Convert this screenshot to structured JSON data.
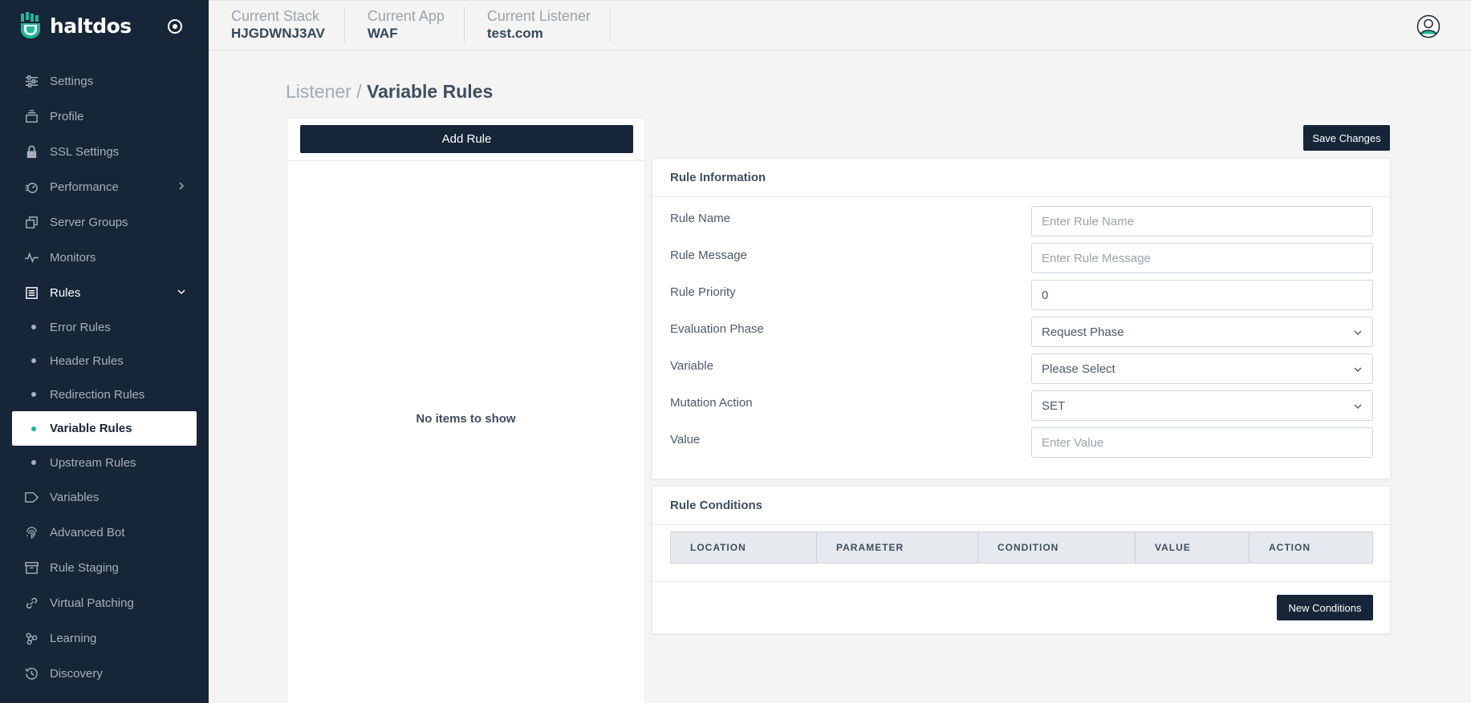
{
  "brand": {
    "name": "haltdos"
  },
  "colors": {
    "sidebar_bg": "#172538",
    "accent": "#1fb89a",
    "page_bg": "#f3f4f3"
  },
  "sidebar": {
    "items": [
      {
        "label": "Settings",
        "icon": "sliders-icon"
      },
      {
        "label": "Profile",
        "icon": "layers-icon"
      },
      {
        "label": "SSL Settings",
        "icon": "lock-icon"
      },
      {
        "label": "Performance",
        "icon": "speedometer-icon"
      },
      {
        "label": "Server Groups",
        "icon": "copy-icon"
      },
      {
        "label": "Monitors",
        "icon": "pulse-icon"
      },
      {
        "label": "Rules",
        "icon": "list-icon"
      }
    ],
    "sub_items": [
      {
        "label": "Error Rules"
      },
      {
        "label": "Header Rules"
      },
      {
        "label": "Redirection Rules"
      },
      {
        "label": "Variable Rules"
      },
      {
        "label": "Upstream Rules"
      }
    ],
    "items_after": [
      {
        "label": "Variables",
        "icon": "tag-icon"
      },
      {
        "label": "Advanced Bot",
        "icon": "fingerprint-icon"
      },
      {
        "label": "Rule Staging",
        "icon": "archive-icon"
      },
      {
        "label": "Virtual Patching",
        "icon": "link-icon"
      },
      {
        "label": "Learning",
        "icon": "network-icon"
      },
      {
        "label": "Discovery",
        "icon": "history-icon"
      }
    ]
  },
  "topbar": {
    "stack_label": "Current Stack",
    "stack_value": "HJGDWNJ3AV",
    "app_label": "Current App",
    "app_value": "WAF",
    "listener_label": "Current Listener",
    "listener_value": "test.com"
  },
  "breadcrumb": {
    "parent": "Listener /",
    "current": "Variable Rules"
  },
  "left_panel": {
    "add_rule_label": "Add Rule",
    "empty_text": "No items to show"
  },
  "save_label": "Save Changes",
  "rule_info": {
    "title": "Rule Information",
    "fields": [
      {
        "label": "Rule Name",
        "placeholder": "Enter Rule Name",
        "value": ""
      },
      {
        "label": "Rule Message",
        "placeholder": "Enter Rule Message",
        "value": ""
      },
      {
        "label": "Rule Priority",
        "placeholder": "",
        "value": "0"
      },
      {
        "label": "Evaluation Phase",
        "selected": "Request Phase"
      },
      {
        "label": "Variable",
        "selected": "Please Select"
      },
      {
        "label": "Mutation Action",
        "selected": "SET"
      },
      {
        "label": "Value",
        "placeholder": "Enter Value",
        "value": ""
      }
    ]
  },
  "rule_conditions": {
    "title": "Rule Conditions",
    "columns": [
      "LOCATION",
      "PARAMETER",
      "CONDITION",
      "VALUE",
      "ACTION"
    ],
    "new_label": "New Conditions"
  }
}
